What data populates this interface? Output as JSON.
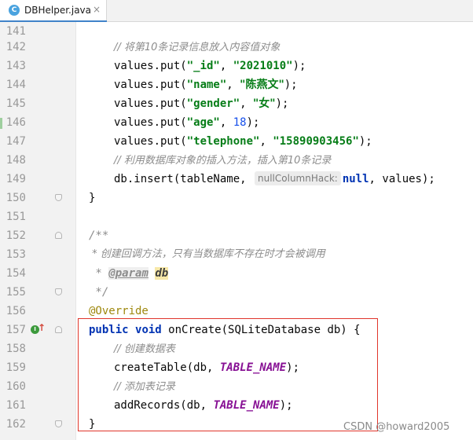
{
  "tab": {
    "title": "DBHelper.java",
    "icon_letter": "C",
    "close_glyph": "×"
  },
  "lines": {
    "l141": {
      "num": "141"
    },
    "l142": {
      "num": "142",
      "comment": "// 将第10条记录信息放入内容值对象"
    },
    "l143": {
      "num": "143",
      "call": "values.put(",
      "key": "\"_id\"",
      "sep": ", ",
      "val": "\"2021010\"",
      "end": ");"
    },
    "l144": {
      "num": "144",
      "call": "values.put(",
      "key": "\"name\"",
      "sep": ", ",
      "val": "\"陈燕文\"",
      "end": ");"
    },
    "l145": {
      "num": "145",
      "call": "values.put(",
      "key": "\"gender\"",
      "sep": ", ",
      "val": "\"女\"",
      "end": ");"
    },
    "l146": {
      "num": "146",
      "call": "values.put(",
      "key": "\"age\"",
      "sep": ", ",
      "val": "18",
      "end": ");"
    },
    "l147": {
      "num": "147",
      "call": "values.put(",
      "key": "\"telephone\"",
      "sep": ", ",
      "val": "\"15890903456\"",
      "end": ");"
    },
    "l148": {
      "num": "148",
      "comment": "// 利用数据库对象的插入方法，插入第10条记录"
    },
    "l149": {
      "num": "149",
      "pre": "db.insert(tableName, ",
      "hint": "nullColumnHack:",
      "kw": "null",
      "post": ", values);"
    },
    "l150": {
      "num": "150",
      "text": "}"
    },
    "l151": {
      "num": "151"
    },
    "l152": {
      "num": "152",
      "text": "/**"
    },
    "l153": {
      "num": "153",
      "text": " * 创建回调方法，只有当数据库不存在时才会被调用"
    },
    "l154": {
      "num": "154",
      "star": " * ",
      "tag": "@param",
      "param": "db"
    },
    "l155": {
      "num": "155",
      "text": " */"
    },
    "l156": {
      "num": "156",
      "text": "@Override"
    },
    "l157": {
      "num": "157",
      "kw1": "public",
      "kw2": "void",
      "rest": " onCreate(SQLiteDatabase db) {",
      "impl_icon": "I",
      "impl_arrow": "↑"
    },
    "l158": {
      "num": "158",
      "comment": "// 创建数据表"
    },
    "l159": {
      "num": "159",
      "pre": "createTable(db, ",
      "const": "TABLE_NAME",
      "post": ");"
    },
    "l160": {
      "num": "160",
      "comment": "// 添加表记录"
    },
    "l161": {
      "num": "161",
      "pre": "addRecords(db, ",
      "const": "TABLE_NAME",
      "post": ");"
    },
    "l162": {
      "num": "162",
      "text": "}"
    }
  },
  "watermark": "CSDN @howard2005",
  "colors": {
    "keyword": "#0033b3",
    "string": "#067d17",
    "number": "#1750eb",
    "comment": "#8c8c8c",
    "constant": "#871094",
    "annotation": "#9e880d",
    "highlight_box": "#e0352b"
  }
}
